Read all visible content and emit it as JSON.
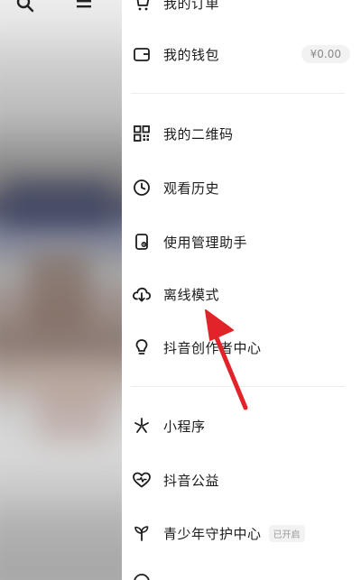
{
  "menu": {
    "orders_label": "我的订单",
    "wallet_label": "我的钱包",
    "wallet_balance": "¥0.00",
    "qrcode_label": "我的二维码",
    "history_label": "观看历史",
    "manager_label": "使用管理助手",
    "offline_label": "离线模式",
    "creator_label": "抖音创作者中心",
    "miniprogram_label": "小程序",
    "charity_label": "抖音公益",
    "youth_label": "青少年守护中心",
    "youth_tag": "已开启"
  },
  "colors": {
    "icon": "#1c1c1c",
    "arrow": "#e0242a",
    "divider": "#ededed"
  },
  "icons": {
    "search": "search-icon",
    "menu": "menu-icon",
    "cart": "cart-icon",
    "wallet": "wallet-icon",
    "qrcode": "qrcode-icon",
    "history": "clock-icon",
    "manager": "phone-icon",
    "offline": "cloud-download-icon",
    "creator": "lightbulb-icon",
    "miniprogram": "sparkle-icon",
    "charity": "heart-icon",
    "youth": "sprout-icon"
  }
}
